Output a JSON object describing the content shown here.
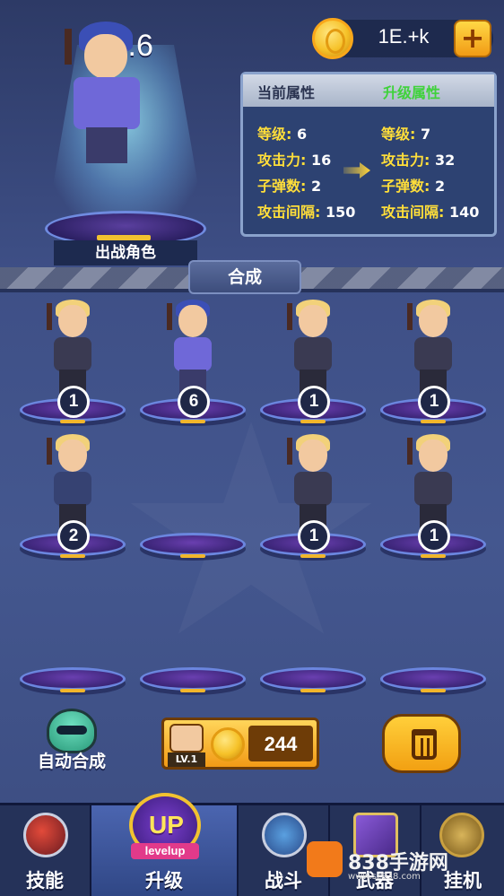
{
  "hero": {
    "level": "Lv.6",
    "caption": "出战角色"
  },
  "currency": {
    "value": "1E.+k",
    "icon": "coin-icon",
    "plus_icon": "plus-icon"
  },
  "stats": {
    "current_title": "当前属性",
    "upgrade_title": "升级属性",
    "current": [
      {
        "key": "等级:",
        "value": "6"
      },
      {
        "key": "攻击力:",
        "value": "16"
      },
      {
        "key": "子弹数:",
        "value": "2"
      },
      {
        "key": "攻击间隔:",
        "value": "150"
      }
    ],
    "upgrade": [
      {
        "key": "等级:",
        "value": "7"
      },
      {
        "key": "攻击力:",
        "value": "32"
      },
      {
        "key": "子弹数:",
        "value": "2"
      },
      {
        "key": "攻击间隔:",
        "value": "140"
      }
    ]
  },
  "merge_tab": "合成",
  "slots": [
    {
      "level": "1",
      "character": "blonde"
    },
    {
      "level": "6",
      "character": "blue-hair"
    },
    {
      "level": "1",
      "character": "blonde"
    },
    {
      "level": "1",
      "character": "blonde"
    },
    {
      "level": "2",
      "character": "blonde-tee"
    },
    {
      "level": "",
      "character": ""
    },
    {
      "level": "1",
      "character": "blonde"
    },
    {
      "level": "1",
      "character": "blonde"
    },
    {
      "level": "",
      "character": ""
    },
    {
      "level": "",
      "character": ""
    },
    {
      "level": "",
      "character": ""
    },
    {
      "level": "",
      "character": ""
    }
  ],
  "controls": {
    "auto_merge_label": "自动合成",
    "buy_level": "LV.1",
    "buy_cost": "244",
    "trash_icon": "trash-icon"
  },
  "nav": {
    "items": [
      {
        "label": "技能",
        "icon": "rocket-icon"
      },
      {
        "label": "升级",
        "icon": "upgrade-icon",
        "badge_top": "UP",
        "badge_ribbon": "levelup",
        "active": true
      },
      {
        "label": "战斗",
        "icon": "crossed-guns-icon"
      },
      {
        "label": "武器",
        "icon": "rifle-icon"
      },
      {
        "label": "挂机",
        "icon": "idle-icon"
      }
    ]
  },
  "watermark": {
    "text": "838手游网",
    "url": "www.sz838.com"
  }
}
